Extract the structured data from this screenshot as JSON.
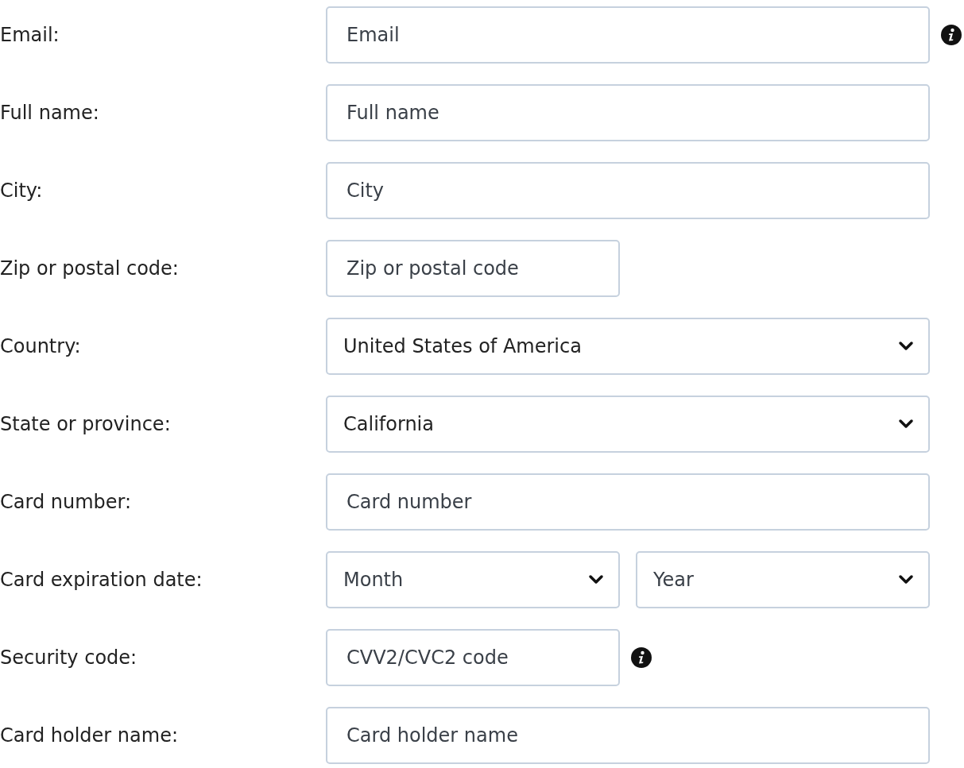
{
  "form": {
    "rows": [
      {
        "label": "Email:",
        "kind": "text",
        "placeholder": "Email",
        "info": true
      },
      {
        "label": "Full name:",
        "kind": "text",
        "placeholder": "Full name"
      },
      {
        "label": "City:",
        "kind": "text",
        "placeholder": "City"
      },
      {
        "label": "Zip or postal code:",
        "kind": "short_text",
        "placeholder": "Zip or postal code"
      },
      {
        "label": "Country:",
        "kind": "select",
        "value": "United States of America"
      },
      {
        "label": "State or province:",
        "kind": "select",
        "value": "California"
      },
      {
        "label": "Card number:",
        "kind": "text",
        "placeholder": "Card number"
      },
      {
        "label": "Card expiration date:",
        "kind": "select_pair",
        "placeholders": [
          "Month",
          "Year"
        ]
      },
      {
        "label": "Security code:",
        "kind": "short_text",
        "placeholder": "CVV2/CVC2 code",
        "info": true
      },
      {
        "label": "Card holder name:",
        "kind": "text",
        "placeholder": "Card holder name"
      }
    ]
  }
}
